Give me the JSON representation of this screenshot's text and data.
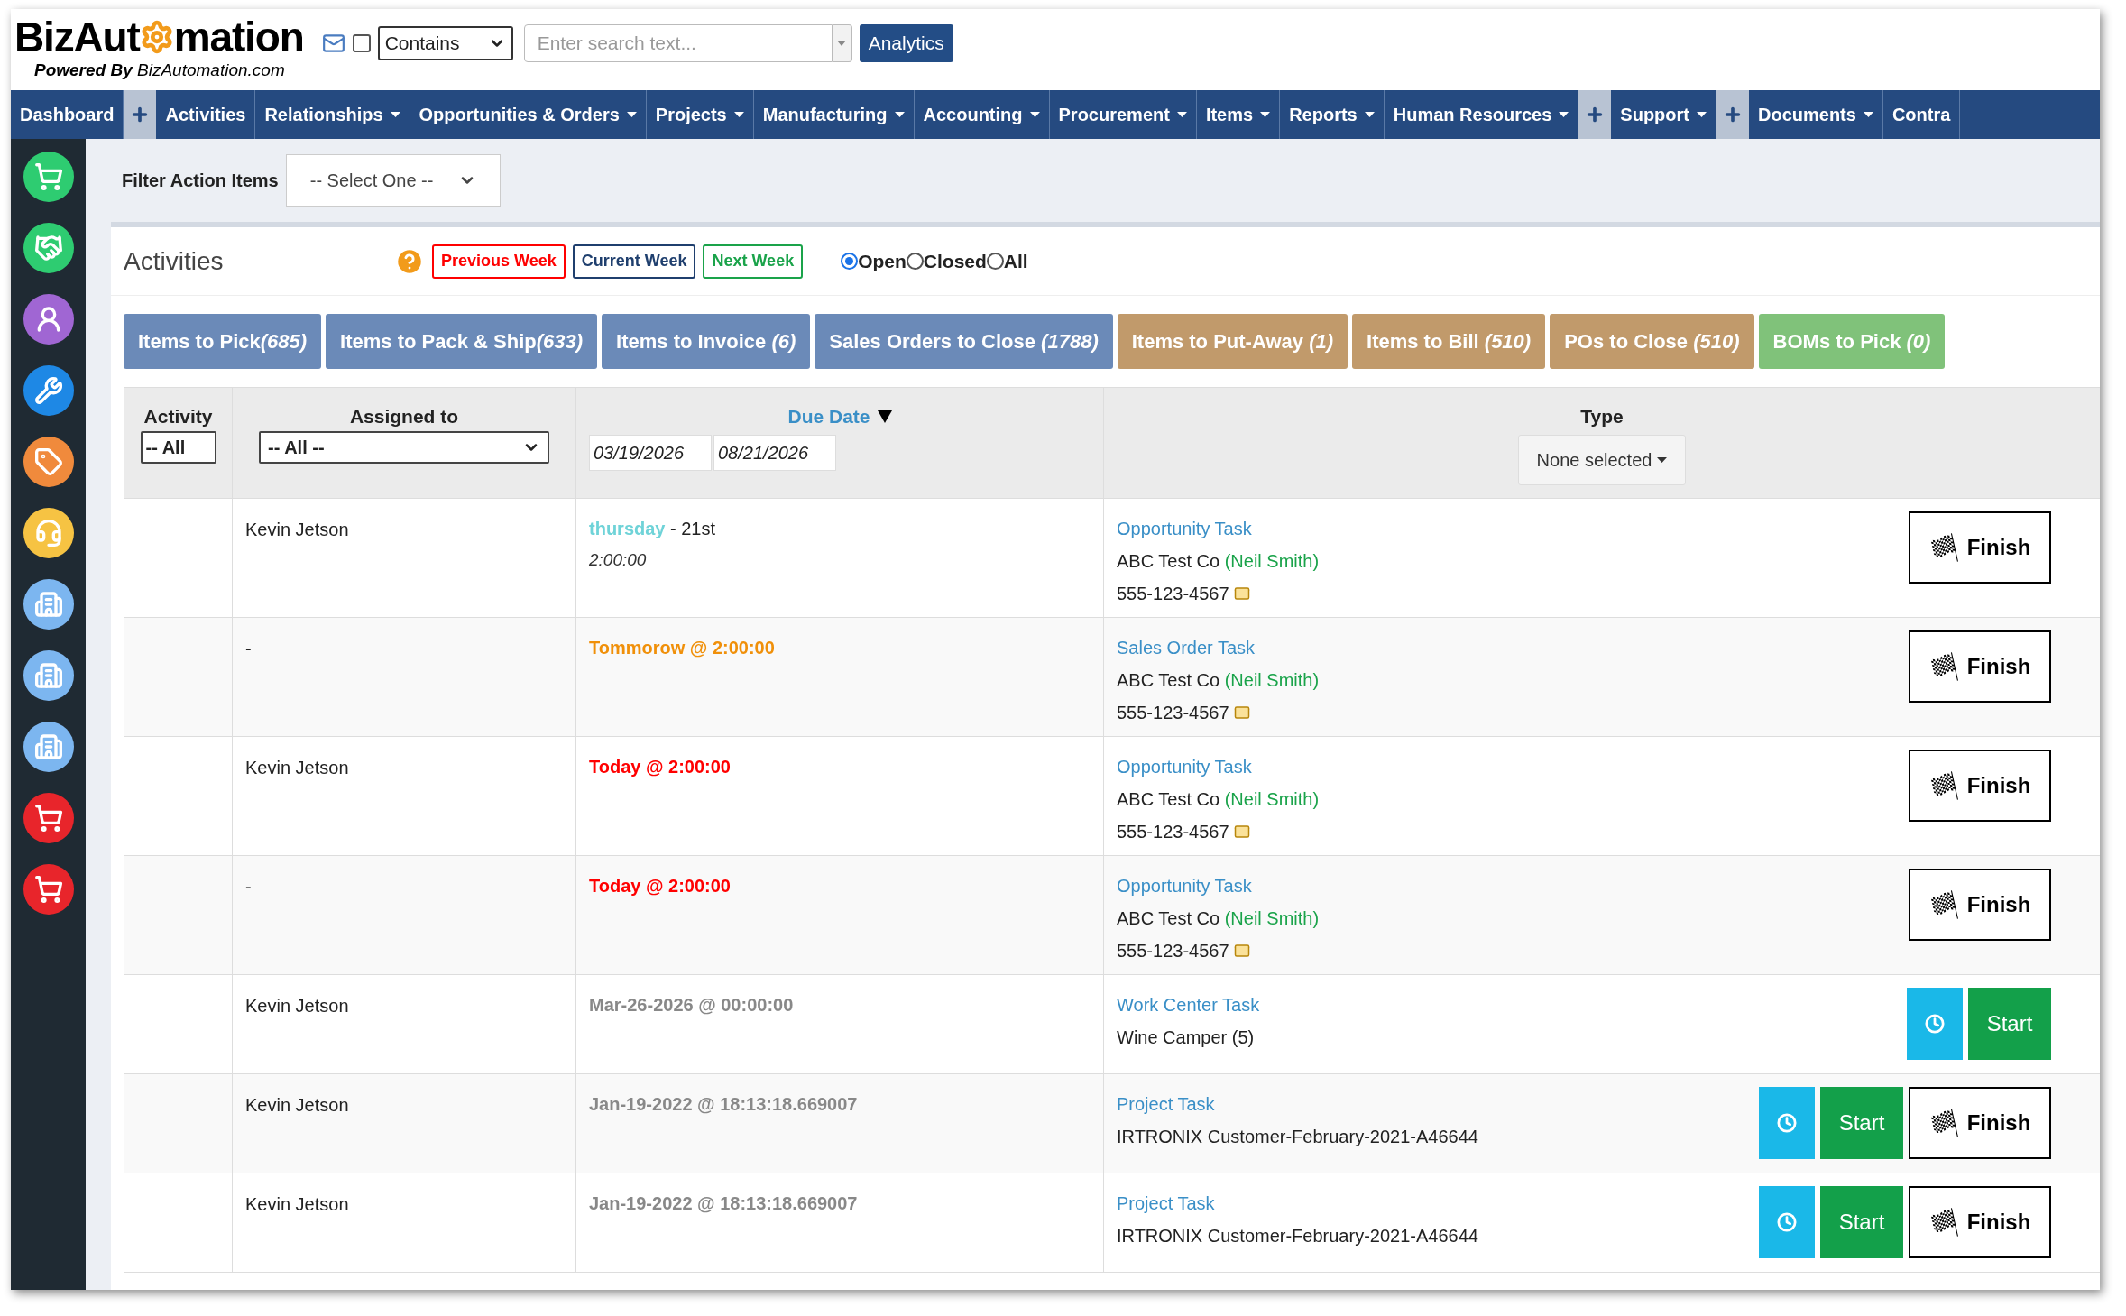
{
  "header": {
    "logo": {
      "left": "BizAut",
      "right": "mation",
      "tagline_bold": "Powered By",
      "tagline": "BizAutomation.com"
    },
    "search": {
      "checked": false,
      "mode": "Contains",
      "placeholder": "Enter search text...",
      "button": "Analytics"
    }
  },
  "nav": [
    {
      "kind": "link",
      "label": "Dashboard",
      "dropdown": false
    },
    {
      "kind": "plus"
    },
    {
      "kind": "link",
      "label": "Activities",
      "dropdown": false
    },
    {
      "kind": "link",
      "label": "Relationships",
      "dropdown": true
    },
    {
      "kind": "link",
      "label": "Opportunities & Orders",
      "dropdown": true
    },
    {
      "kind": "link",
      "label": "Projects",
      "dropdown": true
    },
    {
      "kind": "link",
      "label": "Manufacturing",
      "dropdown": true
    },
    {
      "kind": "link",
      "label": "Accounting",
      "dropdown": true
    },
    {
      "kind": "link",
      "label": "Procurement",
      "dropdown": true
    },
    {
      "kind": "link",
      "label": "Items",
      "dropdown": true
    },
    {
      "kind": "link",
      "label": "Reports",
      "dropdown": true
    },
    {
      "kind": "link",
      "label": "Human Resources",
      "dropdown": true
    },
    {
      "kind": "plus"
    },
    {
      "kind": "link",
      "label": "Support",
      "dropdown": true
    },
    {
      "kind": "plus"
    },
    {
      "kind": "link",
      "label": "Documents",
      "dropdown": true
    },
    {
      "kind": "link",
      "label": "Contra",
      "dropdown": false
    }
  ],
  "filter": {
    "label": "Filter Action Items",
    "value": "-- Select One --"
  },
  "activities": {
    "title": "Activities",
    "weeks": [
      {
        "label": "Previous Week",
        "color": "#ff0000"
      },
      {
        "label": "Current Week",
        "color": "#1f3f6e"
      },
      {
        "label": "Next Week",
        "color": "#1aa34a"
      }
    ],
    "status": [
      {
        "label": "Open",
        "selected": true
      },
      {
        "label": "Closed",
        "selected": false
      },
      {
        "label": "All",
        "selected": false
      }
    ]
  },
  "queues": [
    {
      "label": "Items to Pick",
      "count": "(685)",
      "color": "#6b8ab8"
    },
    {
      "label": "Items to Pack & Ship",
      "count": "(633)",
      "color": "#6b8ab8"
    },
    {
      "label": "Items to Invoice ",
      "count": "(6)",
      "color": "#6b8ab8"
    },
    {
      "label": "Sales Orders to Close ",
      "count": "(1788)",
      "color": "#6b8ab8"
    },
    {
      "label": "Items to Put-Away ",
      "count": "(1)",
      "color": "#c19a6b"
    },
    {
      "label": "Items to Bill ",
      "count": "(510)",
      "color": "#c19a6b"
    },
    {
      "label": "POs to Close ",
      "count": "(510)",
      "color": "#c19a6b"
    },
    {
      "label": "BOMs to Pick ",
      "count": "(0)",
      "color": "#80c27a"
    }
  ],
  "table": {
    "columns": {
      "activity": "Activity",
      "activity_filter": "-- All",
      "assigned": "Assigned to",
      "assigned_filter": "-- All --",
      "due": "Due Date",
      "due_from": "03/19/2026",
      "due_to": "08/21/2026",
      "type": "Type",
      "type_filter": "None selected"
    },
    "rows": [
      {
        "assigned": "Kevin Jetson",
        "due": {
          "kind": "weekday",
          "day": "thursday",
          "date": " - 21st",
          "time": "2:00:00"
        },
        "task": "Opportunity Task",
        "company": "ABC Test Co",
        "contact": "(Neil Smith)",
        "phone": "555-123-4567",
        "actions": [
          {
            "kind": "finish",
            "label": "Finish"
          }
        ]
      },
      {
        "assigned": "-",
        "due": {
          "kind": "tomorrow",
          "text": "Tommorow @ 2:00:00"
        },
        "task": "Sales Order Task",
        "company": "ABC Test Co",
        "contact": "(Neil Smith)",
        "phone": "555-123-4567",
        "actions": [
          {
            "kind": "finish",
            "label": "Finish"
          }
        ]
      },
      {
        "assigned": "Kevin Jetson",
        "due": {
          "kind": "today",
          "text": "Today @ 2:00:00"
        },
        "task": "Opportunity Task",
        "company": "ABC Test Co",
        "contact": "(Neil Smith)",
        "phone": "555-123-4567",
        "actions": [
          {
            "kind": "finish",
            "label": "Finish"
          }
        ]
      },
      {
        "assigned": "-",
        "due": {
          "kind": "today",
          "text": "Today @ 2:00:00"
        },
        "task": "Opportunity Task",
        "company": "ABC Test Co",
        "contact": "(Neil Smith)",
        "phone": "555-123-4567",
        "actions": [
          {
            "kind": "finish",
            "label": "Finish"
          }
        ]
      },
      {
        "assigned": "Kevin Jetson",
        "due": {
          "kind": "past",
          "text": "Mar-26-2026 @ 00:00:00"
        },
        "task": "Work Center Task",
        "company": "Wine Camper (5)",
        "actions": [
          {
            "kind": "timer"
          },
          {
            "kind": "start",
            "label": "Start"
          }
        ]
      },
      {
        "assigned": "Kevin Jetson",
        "due": {
          "kind": "past",
          "text": "Jan-19-2022 @ 18:13:18.669007"
        },
        "task": "Project Task",
        "company": "IRTRONIX Customer-February-2021-A46644",
        "actions": [
          {
            "kind": "timer"
          },
          {
            "kind": "start",
            "label": "Start"
          },
          {
            "kind": "finish",
            "label": "Finish"
          }
        ]
      },
      {
        "assigned": "Kevin Jetson",
        "due": {
          "kind": "past",
          "text": "Jan-19-2022 @ 18:13:18.669007"
        },
        "task": "Project Task",
        "company": "IRTRONIX Customer-February-2021-A46644",
        "actions": [
          {
            "kind": "timer"
          },
          {
            "kind": "start",
            "label": "Start"
          },
          {
            "kind": "finish",
            "label": "Finish"
          }
        ]
      }
    ]
  }
}
